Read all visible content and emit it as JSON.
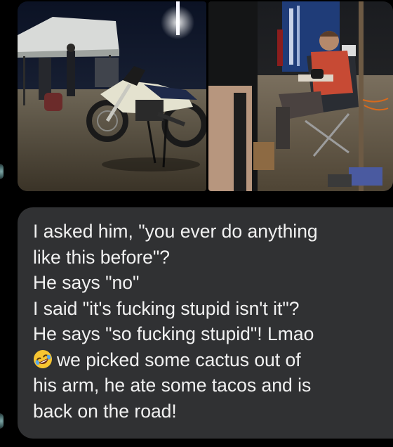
{
  "conversation": {
    "photos": [
      {
        "id": "campsite-dirtbike-photo",
        "subject": "dirt bike on stand at night campsite"
      },
      {
        "id": "rider-in-chair-photo",
        "subject": "rider in folding chair tending his arm"
      }
    ],
    "message": {
      "lines": [
        "I asked him, \"you ever do anything",
        "like this before\"?",
        "He says \"no\"",
        "I said \"it's fucking stupid isn't it\"?",
        "He says \"so fucking stupid\"! Lmao",
        "we picked some cactus out of",
        "his arm, he ate some tacos and is",
        "back on the road!"
      ],
      "emoji": "rolling-on-floor-laughing-icon"
    },
    "colors": {
      "background": "#000000",
      "bubble": "#303133",
      "text": "#f1f1f1"
    }
  }
}
